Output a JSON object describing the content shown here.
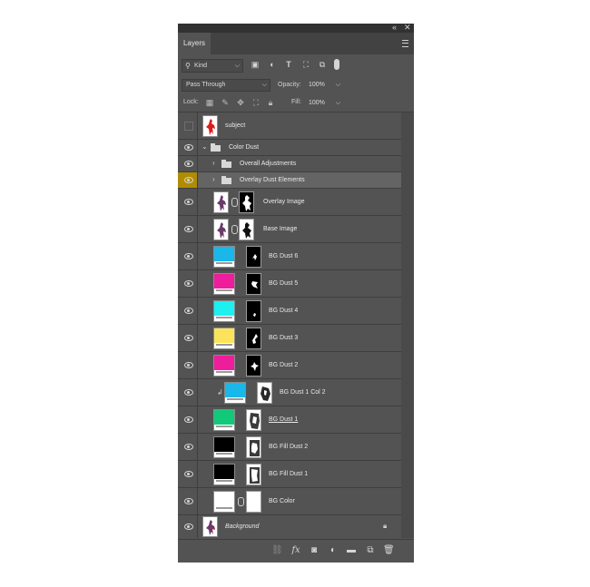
{
  "panel": {
    "collapse_glyph": "«",
    "close_glyph": "✕",
    "tab_label": "Layers",
    "menu_icon": "panel-menu-icon"
  },
  "filter": {
    "kind_label": "Kind",
    "icons": [
      "image-filter-icon",
      "adjustment-filter-icon",
      "type-filter-icon",
      "shape-filter-icon",
      "smart-object-filter-icon"
    ]
  },
  "blend": {
    "mode": "Pass Through",
    "opacity_label": "Opacity:",
    "opacity_value": "100%"
  },
  "lock": {
    "label": "Lock:",
    "fill_label": "Fill:",
    "fill_value": "100%"
  },
  "layers": [
    {
      "name": "subject",
      "visible": false,
      "kind": "image"
    },
    {
      "name": "Color Dust",
      "visible": true,
      "kind": "group",
      "expanded": true
    },
    {
      "name": "Overall Adjustments",
      "visible": true,
      "kind": "group"
    },
    {
      "name": "Overlay Dust Elements",
      "visible": true,
      "kind": "group",
      "selected": true
    },
    {
      "name": "Overlay Image",
      "visible": true,
      "kind": "image-mask"
    },
    {
      "name": "Base Image",
      "visible": true,
      "kind": "image-mask"
    },
    {
      "name": "BG Dust 6",
      "visible": true,
      "kind": "fill",
      "color": "#1ab7ea"
    },
    {
      "name": "BG Dust 5",
      "visible": true,
      "kind": "fill",
      "color": "#ee1d9b"
    },
    {
      "name": "BG Dust 4",
      "visible": true,
      "kind": "fill",
      "color": "#1df0f0"
    },
    {
      "name": "BG Dust 3",
      "visible": true,
      "kind": "fill",
      "color": "#fbe45b"
    },
    {
      "name": "BG Dust 2",
      "visible": true,
      "kind": "fill",
      "color": "#ee1d9b"
    },
    {
      "name": "BG Dust 1 Col 2",
      "visible": true,
      "kind": "fill",
      "color": "#1ab7ea",
      "clipped": true
    },
    {
      "name": "BG Dust 1",
      "visible": true,
      "kind": "fill",
      "color": "#10c97a"
    },
    {
      "name": "BG Fill Dust 2",
      "visible": true,
      "kind": "fill",
      "color": "#000000"
    },
    {
      "name": "BG Fill Dust 1",
      "visible": true,
      "kind": "fill",
      "color": "#000000"
    },
    {
      "name": "BG Color",
      "visible": true,
      "kind": "fill",
      "color": "#ffffff"
    },
    {
      "name": "Background",
      "visible": true,
      "kind": "background"
    }
  ],
  "footer_icons": [
    "link-layers-icon",
    "fx-icon",
    "add-mask-icon",
    "adjustment-layer-icon",
    "new-group-icon",
    "new-layer-icon",
    "delete-layer-icon"
  ],
  "colors": {
    "panel_bg": "#535353",
    "selected_row": "#646464",
    "highlight_eye": "#b08c00"
  }
}
